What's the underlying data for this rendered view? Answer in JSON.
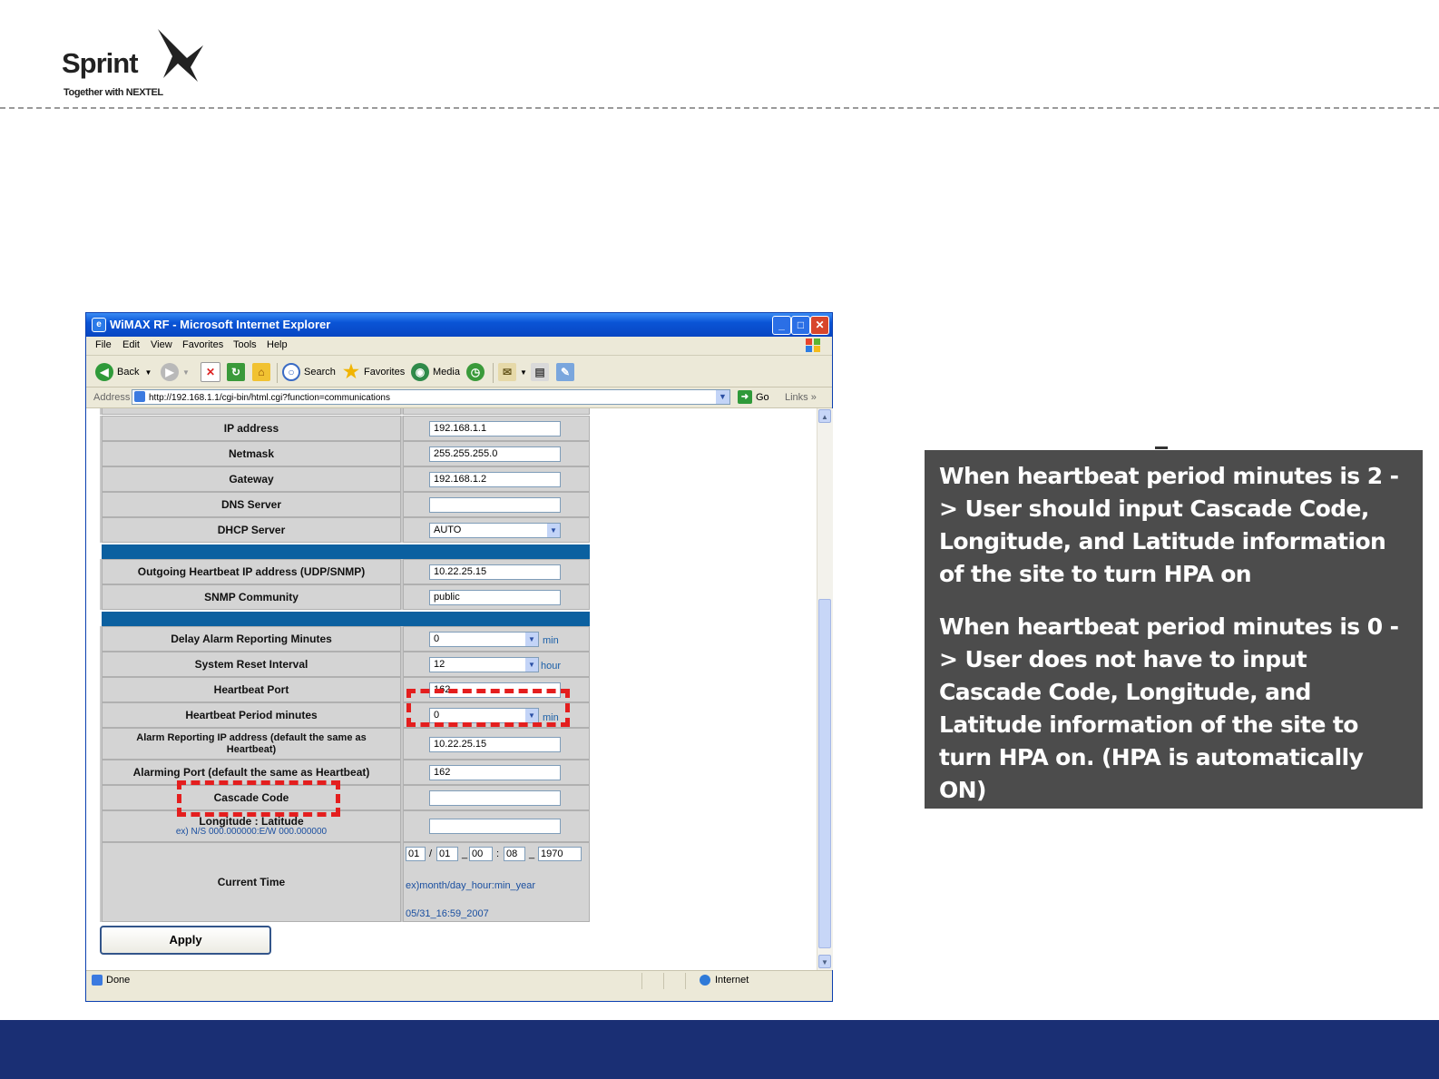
{
  "slide": {
    "logo": {
      "word": "Sprint",
      "tagline": "Together with NEXTEL"
    },
    "callout": {
      "paragraph1": "When heartbeat period minutes is 2 -> User should input Cascade Code, Longitude, and Latitude information of the site to turn HPA on",
      "paragraph2": "When heartbeat period minutes is 0 -> User does not have to input Cascade Code, Longitude, and Latitude information of the site to turn HPA on. (HPA is automatically ON)"
    },
    "colors": {
      "footer_band": "#1a2f74",
      "callout_bg": "#4c4c4c",
      "highlight": "#e41e1e",
      "section_band": "#0b60a0"
    }
  },
  "browser": {
    "title": "WiMAX RF - Microsoft Internet Explorer",
    "menu": [
      "File",
      "Edit",
      "View",
      "Favorites",
      "Tools",
      "Help"
    ],
    "toolbar": {
      "back": "Back",
      "search": "Search",
      "favorites": "Favorites",
      "media": "Media"
    },
    "address_label": "Address",
    "address_url": "http://192.168.1.1/cgi-bin/html.cgi?function=communications",
    "go_label": "Go",
    "links_label": "Links",
    "status_text": "Done",
    "zone_text": "Internet"
  },
  "form": {
    "ip_address": {
      "label": "IP address",
      "value": "192.168.1.1"
    },
    "netmask": {
      "label": "Netmask",
      "value": "255.255.255.0"
    },
    "gateway": {
      "label": "Gateway",
      "value": "192.168.1.2"
    },
    "dns_server": {
      "label": "DNS Server",
      "value": ""
    },
    "dhcp_server": {
      "label": "DHCP Server",
      "value": "AUTO"
    },
    "outgoing_heartbeat_ip": {
      "label": "Outgoing Heartbeat IP address (UDP/SNMP)",
      "value": "10.22.25.15"
    },
    "snmp_community": {
      "label": "SNMP Community",
      "value": "public"
    },
    "delay_alarm_minutes": {
      "label": "Delay Alarm Reporting Minutes",
      "value": "0",
      "unit": "min"
    },
    "system_reset_interval": {
      "label": "System Reset Interval",
      "value": "12",
      "unit": "hour"
    },
    "heartbeat_port": {
      "label": "Heartbeat Port",
      "value": "162"
    },
    "heartbeat_period": {
      "label": "Heartbeat Period minutes",
      "value": "0",
      "unit": "min"
    },
    "alarm_reporting_ip": {
      "label": "Alarm Reporting IP address (default the same as Heartbeat)",
      "value": "10.22.25.15"
    },
    "alarming_port": {
      "label": "Alarming Port (default the same as Heartbeat)",
      "value": "162"
    },
    "cascade_code": {
      "label": "Cascade Code",
      "value": ""
    },
    "longitude_latitude": {
      "label": "Longitude : Latitude",
      "hint": "ex) N/S 000.000000:E/W 000.000000",
      "value": ""
    },
    "current_time": {
      "label": "Current Time",
      "month": "01",
      "day": "01",
      "hour": "00",
      "minute": "08",
      "year": "1970",
      "sep_slash": "/",
      "sep_underscore": "_",
      "format_hint": "ex)month/day_hour:min_year",
      "reading": "05/31_16:59_2007"
    },
    "apply_label": "Apply"
  }
}
